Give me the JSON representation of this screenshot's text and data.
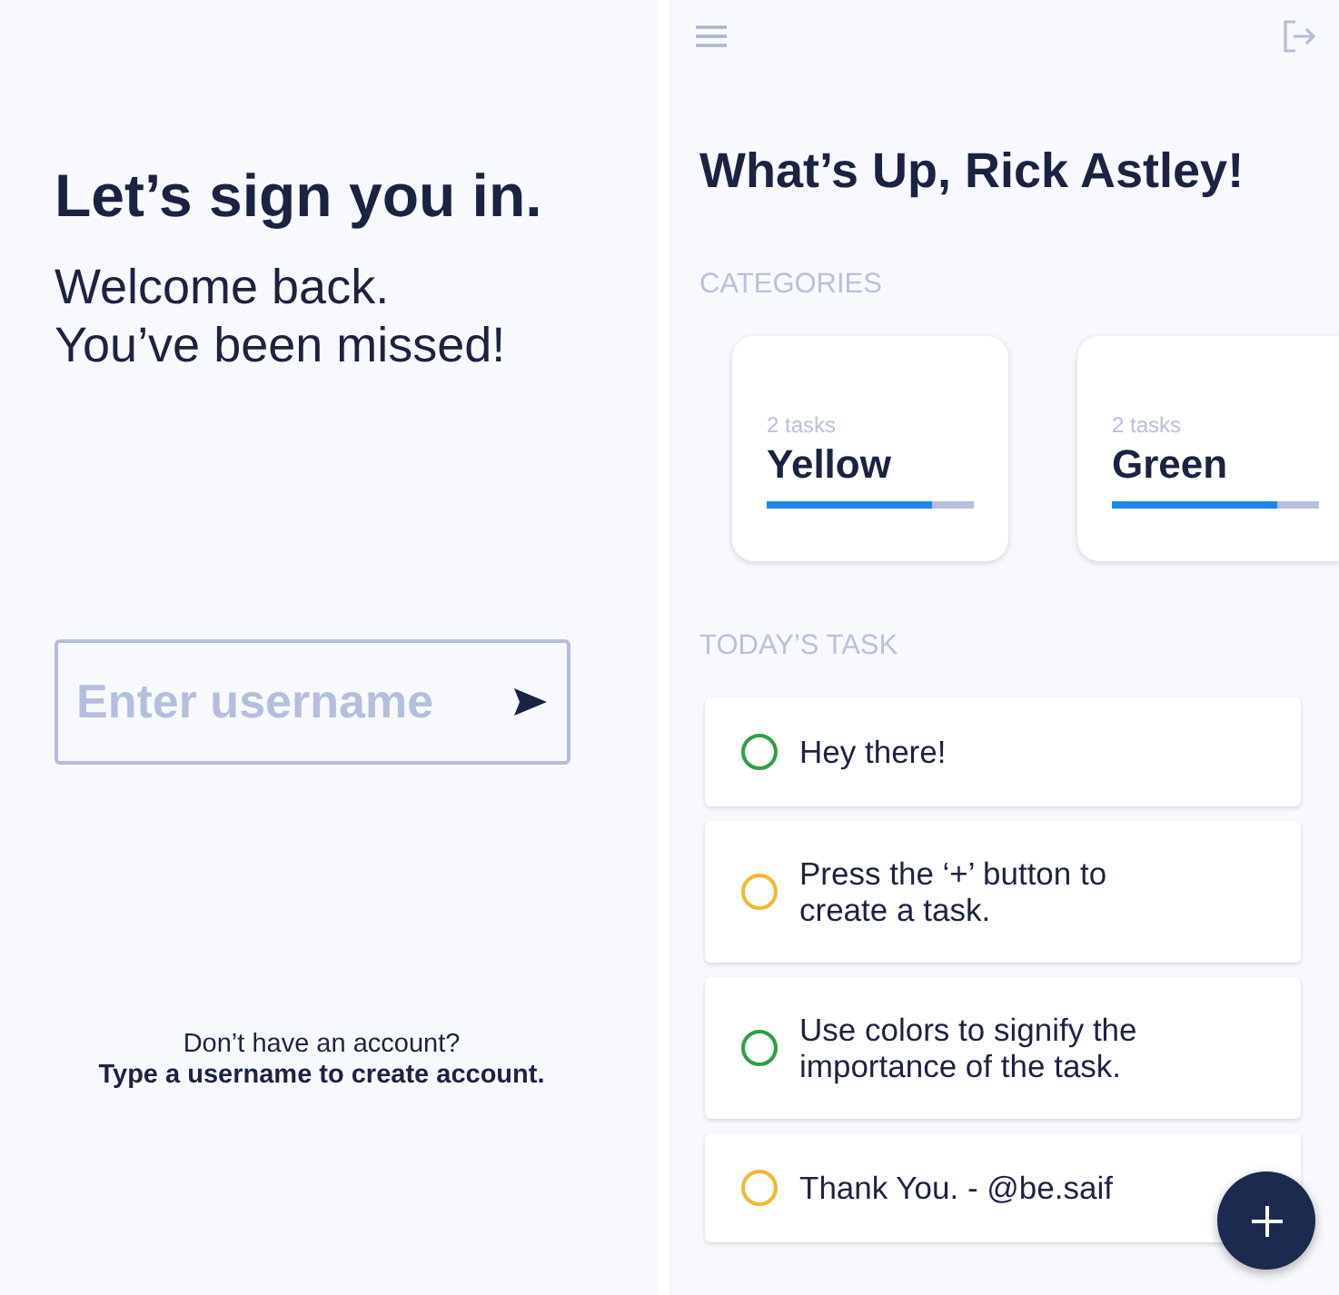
{
  "login_screen": {
    "title": "Let’s sign you in.",
    "subtitle": [
      "Welcome back.",
      "You’ve been missed!"
    ],
    "username_field": {
      "placeholder": "Enter username"
    },
    "footer": {
      "question": "Don’t have an account?",
      "hint": "Type a username to create account."
    }
  },
  "home_screen": {
    "greeting": "What’s Up, Rick Astley!",
    "categories_heading": "CATEGORIES",
    "categories": [
      {
        "count": "2 tasks",
        "name": "Yellow",
        "level": 0.8
      },
      {
        "count": "2 tasks",
        "name": "Green",
        "level": 0.8
      }
    ],
    "tasks_heading": "TODAY’S TASK",
    "tasks": [
      {
        "text": "Hey there!",
        "color": "#2e9f43",
        "checked": false
      },
      {
        "text": "Press the ‘+’ button to create a task.",
        "color": "#f5b731",
        "checked": false
      },
      {
        "text": "Use colors to signify the importance of the task.",
        "color": "#2e9f43",
        "checked": false
      },
      {
        "text": "Thank You. - @be.saif",
        "color": "#f5b731",
        "checked": false
      }
    ]
  }
}
